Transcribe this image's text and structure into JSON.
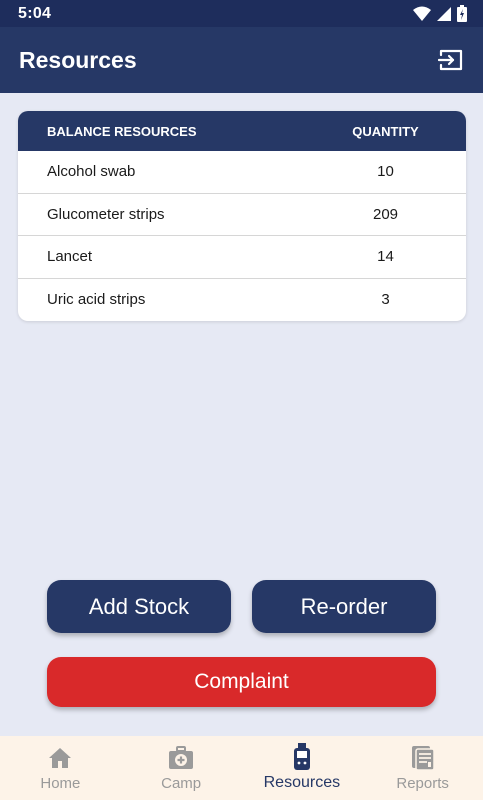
{
  "status_bar": {
    "time": "5:04"
  },
  "app_bar": {
    "title": "Resources"
  },
  "table": {
    "headers": [
      "BALANCE RESOURCES",
      "QUANTITY"
    ],
    "rows": [
      {
        "name": "Alcohol swab",
        "qty": "10"
      },
      {
        "name": "Glucometer strips",
        "qty": "209"
      },
      {
        "name": "Lancet",
        "qty": "14"
      },
      {
        "name": "Uric acid strips",
        "qty": "3"
      }
    ]
  },
  "buttons": {
    "add_stock": "Add Stock",
    "reorder": "Re-order",
    "complaint": "Complaint"
  },
  "bottom_nav": {
    "items": [
      {
        "label": "Home",
        "icon": "home-icon"
      },
      {
        "label": "Camp",
        "icon": "medical-kit-icon"
      },
      {
        "label": "Resources",
        "icon": "glucometer-icon",
        "active": true
      },
      {
        "label": "Reports",
        "icon": "report-icon"
      }
    ]
  },
  "colors": {
    "primary": "#263866",
    "status_bar": "#1e2d5c",
    "background": "#e6e9f4",
    "complaint": "#d9292a",
    "nav_bg": "#fdf3e8"
  }
}
